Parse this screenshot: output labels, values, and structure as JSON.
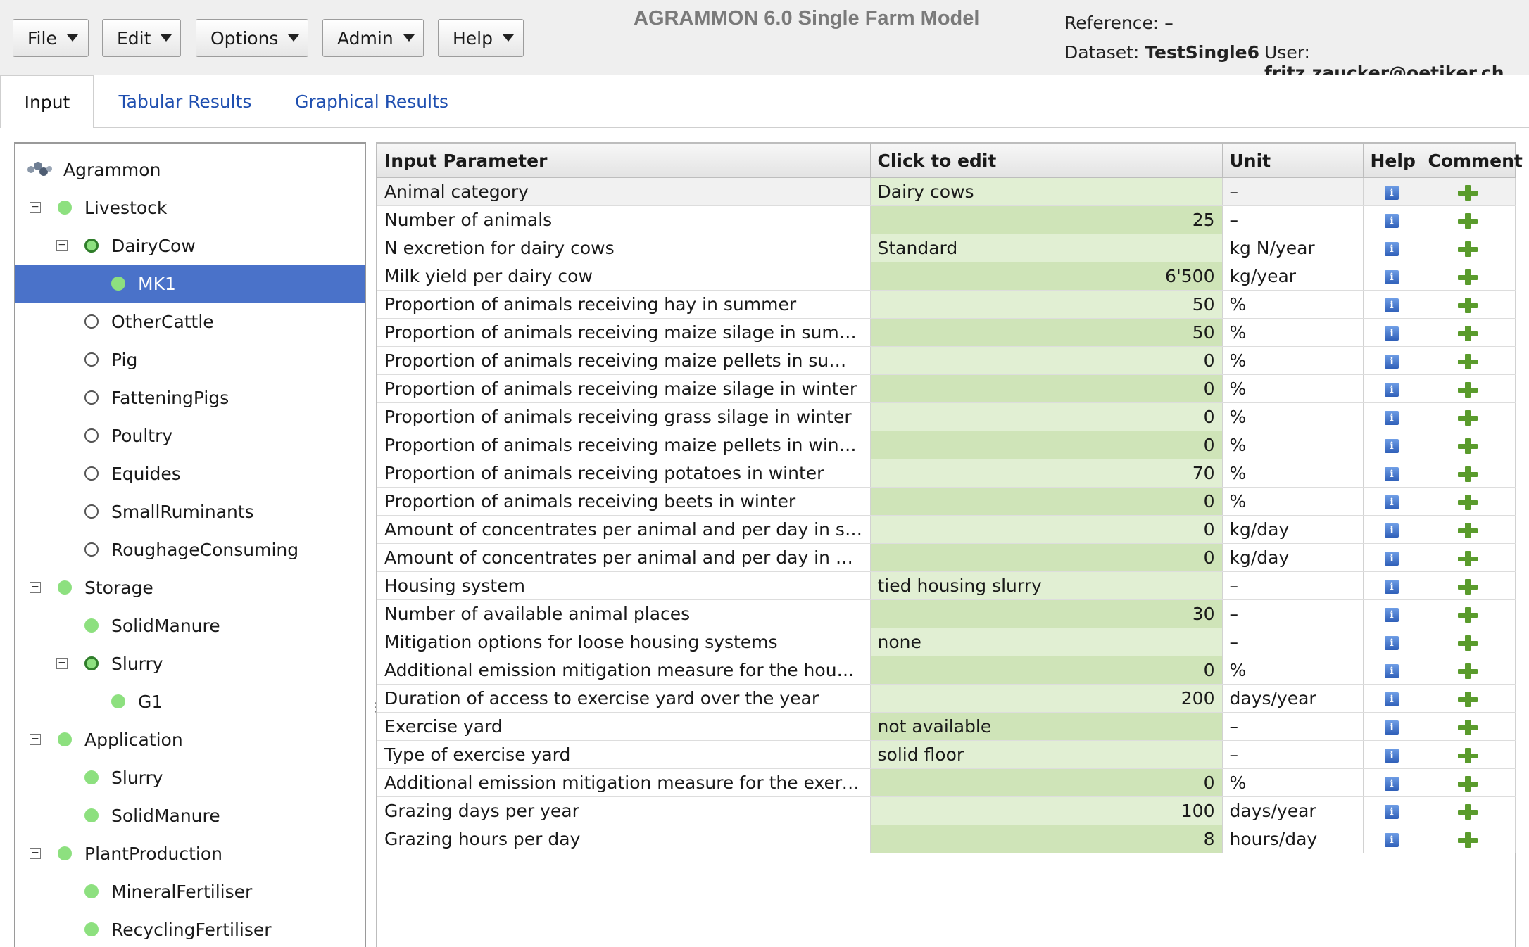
{
  "menu": [
    {
      "label": "File"
    },
    {
      "label": "Edit"
    },
    {
      "label": "Options"
    },
    {
      "label": "Admin"
    },
    {
      "label": "Help"
    }
  ],
  "app_title": "AGRAMMON 6.0 Single Farm Model",
  "reference": {
    "label": "Reference:",
    "value": "–"
  },
  "dataset": {
    "label": "Dataset:",
    "value": "TestSingle6"
  },
  "user": {
    "label": "User:",
    "value": "fritz.zaucker@oetiker.ch"
  },
  "tabs": [
    {
      "label": "Input",
      "active": true
    },
    {
      "label": "Tabular Results"
    },
    {
      "label": "Graphical Results"
    }
  ],
  "tree": {
    "root": "Agrammon",
    "nodes": [
      {
        "label": "Livestock"
      },
      {
        "label": "DairyCow"
      },
      {
        "label": "MK1",
        "selected": true
      },
      {
        "label": "OtherCattle"
      },
      {
        "label": "Pig"
      },
      {
        "label": "FatteningPigs"
      },
      {
        "label": "Poultry"
      },
      {
        "label": "Equides"
      },
      {
        "label": "SmallRuminants"
      },
      {
        "label": "RoughageConsuming"
      },
      {
        "label": "Storage"
      },
      {
        "label": "SolidManure"
      },
      {
        "label": "Slurry"
      },
      {
        "label": "G1"
      },
      {
        "label": "Application"
      },
      {
        "label": "Slurry"
      },
      {
        "label": "SolidManure"
      },
      {
        "label": "PlantProduction"
      },
      {
        "label": "MineralFertiliser"
      },
      {
        "label": "RecyclingFertiliser"
      }
    ]
  },
  "table": {
    "headers": {
      "param": "Input Parameter",
      "edit": "Click to edit",
      "unit": "Unit",
      "help": "Help",
      "comment": "Comment"
    },
    "rows": [
      {
        "param": "Animal category",
        "value": "Dairy cows",
        "unit": "–"
      },
      {
        "param": "Number of animals",
        "value": "25",
        "unit": "–"
      },
      {
        "param": "N excretion for dairy cows",
        "value": "Standard",
        "unit": "kg N/year"
      },
      {
        "param": "Milk yield per dairy cow",
        "value": "6'500",
        "unit": "kg/year"
      },
      {
        "param": "Proportion of animals receiving hay in summer",
        "value": "50",
        "unit": "%"
      },
      {
        "param": "Proportion of animals receiving maize silage in summer",
        "value": "50",
        "unit": "%"
      },
      {
        "param": "Proportion of animals receiving maize pellets in summer",
        "value": "0",
        "unit": "%"
      },
      {
        "param": "Proportion of animals receiving maize silage in winter",
        "value": "0",
        "unit": "%"
      },
      {
        "param": "Proportion of animals receiving grass silage in winter",
        "value": "0",
        "unit": "%"
      },
      {
        "param": "Proportion of animals receiving maize pellets in winter",
        "value": "0",
        "unit": "%"
      },
      {
        "param": "Proportion of animals receiving potatoes in winter",
        "value": "70",
        "unit": "%"
      },
      {
        "param": "Proportion of animals receiving beets in winter",
        "value": "0",
        "unit": "%"
      },
      {
        "param": "Amount of concentrates per animal and per day in sum…",
        "value": "0",
        "unit": "kg/day"
      },
      {
        "param": "Amount of concentrates per animal and per day in winter",
        "value": "0",
        "unit": "kg/day"
      },
      {
        "param": "Housing system",
        "value": "tied housing slurry",
        "unit": "–"
      },
      {
        "param": "Number of available animal places",
        "value": "30",
        "unit": "–"
      },
      {
        "param": "Mitigation options for loose housing systems",
        "value": "none",
        "unit": "–"
      },
      {
        "param": "Additional emission mitigation measure for the housing…",
        "value": "0",
        "unit": "%"
      },
      {
        "param": "Duration of access to exercise yard over the year",
        "value": "200",
        "unit": "days/year"
      },
      {
        "param": "Exercise yard",
        "value": "not available",
        "unit": "–"
      },
      {
        "param": "Type of exercise yard",
        "value": "solid floor",
        "unit": "–"
      },
      {
        "param": "Additional emission mitigation measure for the exercis…",
        "value": "0",
        "unit": "%"
      },
      {
        "param": "Grazing days per year",
        "value": "100",
        "unit": "days/year"
      },
      {
        "param": "Grazing hours per day",
        "value": "8",
        "unit": "hours/day"
      }
    ]
  },
  "colors": {
    "selection": "#4a72c9",
    "edit_cell": "#cfe4b8",
    "edit_cell_alt": "#e1efd3",
    "active_dot": "#8de07f"
  }
}
